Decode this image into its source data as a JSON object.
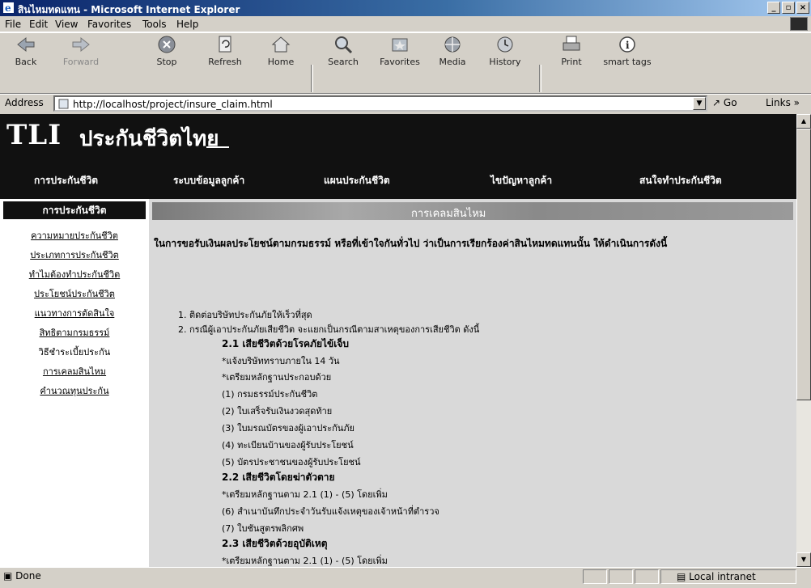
{
  "window": {
    "title": "สินไหมทดแทน - Microsoft Internet Explorer",
    "controls": [
      "_",
      "▫",
      "×"
    ]
  },
  "menu": [
    "File",
    "Edit",
    "View",
    "Favorites",
    "Tools",
    "Help"
  ],
  "toolbar": {
    "back": "Back",
    "forward": "Forward",
    "stop": "Stop",
    "refresh": "Refresh",
    "home": "Home",
    "search": "Search",
    "favorites": "Favorites",
    "media": "Media",
    "history": "History",
    "print": "Print",
    "smart_tags": "smart tags"
  },
  "address": {
    "label": "Address",
    "url": "http://localhost/project/insure_claim.html",
    "go": "Go",
    "links": "Links"
  },
  "site": {
    "logo_en": "TLI",
    "logo_th": "ประกันชีวิตไทย",
    "nav": [
      "การประกันชีวิต",
      "ระบบข้อมูลลูกค้า",
      "แผนประกันชีวิต",
      "ไขปัญหาลูกค้า",
      "สนใจทำประกันชีวิต"
    ]
  },
  "sidebar": {
    "heading": "การประกันชีวิต",
    "items": [
      "ความหมายประกันชีวิต",
      "ประเภทการประกันชีวิต",
      "ทำไมต้องทำประกันชีวิต",
      "ประโยชน์ประกันชีวิต",
      "แนวทางการตัดสินใจ",
      "สิทธิตามกรมธรรม์",
      "วิธีชำระเบี้ยประกัน",
      "การเคลมสินไหม",
      "คำนวณทุนประกัน"
    ]
  },
  "content": {
    "banner": "การเคลมสินไหม",
    "intro": "ในการขอรับเงินผลประโยชน์ตามกรมธรรม์ หรือที่เข้าใจกันทั่วไป ว่าเป็นการเรียกร้องค่าสินไหมทดแทนนั้น ให้ดำเนินการดังนี้",
    "lines": [
      "1. ติดต่อบริษัทประกันภัยให้เร็วที่สุด",
      "2. กรณีผู้เอาประกันภัยเสียชีวิต จะแยกเป็นกรณีตามสาเหตุของการเสียชีวิต ดังนี้",
      "2.1 เสียชีวิตด้วยโรคภัยไข้เจ็บ",
      "*แจ้งบริษัททราบภายใน 14 วัน",
      "*เตรียมหลักฐานประกอบด้วย",
      "(1) กรมธรรม์ประกันชีวิต",
      "(2) ใบเสร็จรับเงินงวดสุดท้าย",
      "(3) ใบมรณบัตรของผู้เอาประกันภัย",
      "(4) ทะเบียนบ้านของผู้รับประโยชน์",
      "(5) บัตรประชาชนของผู้รับประโยชน์",
      "2.2 เสียชีวิตโดยฆ่าตัวตาย",
      "*เตรียมหลักฐานตาม 2.1 (1) - (5) โดยเพิ่ม",
      "(6) สำเนาบันทึกประจำวันรับแจ้งเหตุของเจ้าหน้าที่ตำรวจ",
      "(7) ใบชันสูตรพลิกศพ",
      "2.3 เสียชีวิตด้วยอุบัติเหตุ",
      "*เตรียมหลักฐานตาม 2.1 (1) - (5) โดยเพิ่ม"
    ]
  },
  "status": {
    "left": "Done",
    "zone": "Local intranet"
  },
  "colors": {
    "titlebar": "#0a246a",
    "chrome": "#d4d0c8",
    "site_header": "#111111",
    "content_bg": "#d9d9d9"
  }
}
